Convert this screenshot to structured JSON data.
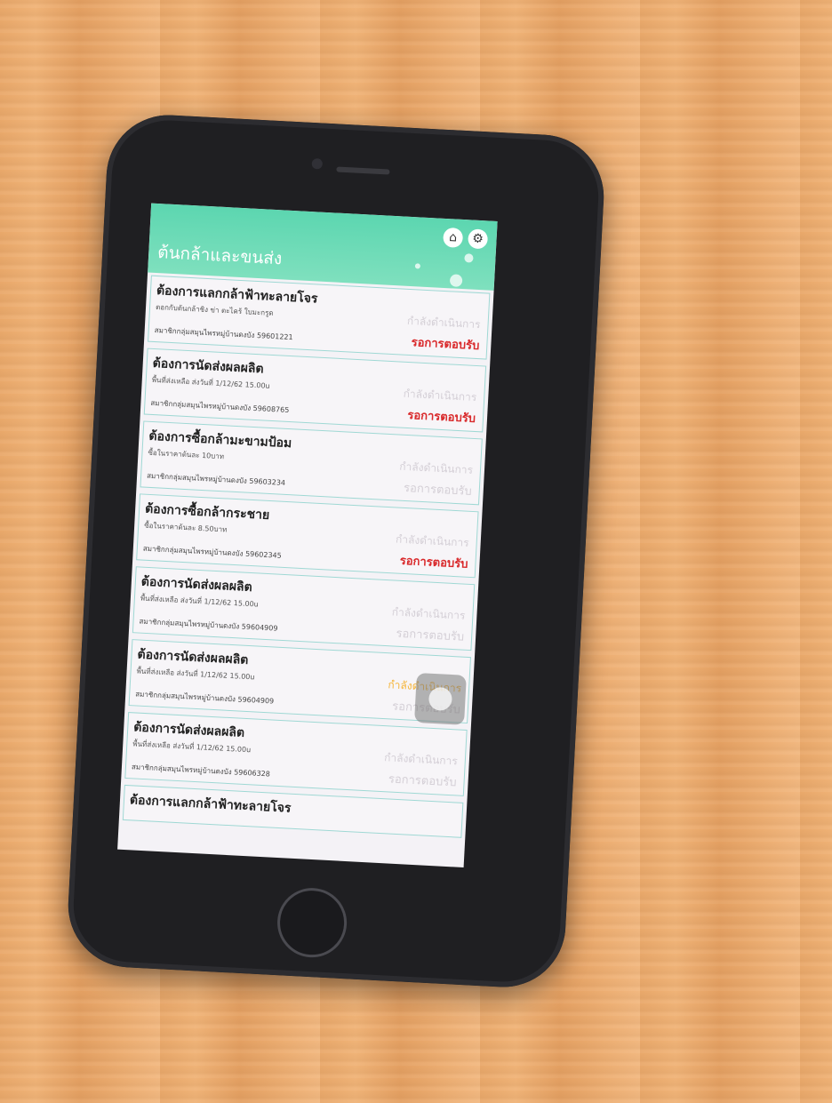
{
  "app": {
    "title": "ต้นกล้าและขนส่ง",
    "home_icon": "home-icon",
    "settings_icon": "gear-icon"
  },
  "cards": [
    {
      "title": "ต้องการแลกกล้าฟ้าทะลายโจร",
      "sub": "ตอกกับต้นกล้าชิง ข่า ตะไคร้ ใบมะกรูด",
      "member": "สมาชิกกลุ่มสมุนไพรหมู่บ้านดงบัง 59601221",
      "progress": "กำลังดำเนินการ",
      "waiting": "รอการตอบรับ",
      "progress_active": false,
      "waiting_active": true
    },
    {
      "title": "ต้องการนัดส่งผลผลิต",
      "sub": "พื้นที่ส่งเหลือ ส่งวันที่ 1/12/62 15.00u",
      "member": "สมาชิกกลุ่มสมุนไพรหมู่บ้านดงบัง 59608765",
      "progress": "กำลังดำเนินการ",
      "waiting": "รอการตอบรับ",
      "progress_active": false,
      "waiting_active": true
    },
    {
      "title": "ต้องการซื้อกล้ามะขามป้อม",
      "sub": "ซื้อในราคาต้นละ 10บาท",
      "member": "สมาชิกกลุ่มสมุนไพรหมู่บ้านดงบัง 59603234",
      "progress": "กำลังดำเนินการ",
      "waiting": "รอการตอบรับ",
      "progress_active": false,
      "waiting_active": false
    },
    {
      "title": "ต้องการซื้อกล้ากระชาย",
      "sub": "ซื้อในราคาต้นละ 8.50บาท",
      "member": "สมาชิกกลุ่มสมุนไพรหมู่บ้านดงบัง 59602345",
      "progress": "กำลังดำเนินการ",
      "waiting": "รอการตอบรับ",
      "progress_active": false,
      "waiting_active": true
    },
    {
      "title": "ต้องการนัดส่งผลผลิต",
      "sub": "พื้นที่ส่งเหลือ ส่งวันที่ 1/12/62 15.00u",
      "member": "สมาชิกกลุ่มสมุนไพรหมู่บ้านดงบัง 59604909",
      "progress": "กำลังดำเนินการ",
      "waiting": "รอการตอบรับ",
      "progress_active": false,
      "waiting_active": false
    },
    {
      "title": "ต้องการนัดส่งผลผลิต",
      "sub": "พื้นที่ส่งเหลือ ส่งวันที่ 1/12/62 15.00u",
      "member": "สมาชิกกลุ่มสมุนไพรหมู่บ้านดงบัง 59604909",
      "progress": "กำลังดำเนินการ",
      "waiting": "รอการตอบรับ",
      "progress_active": true,
      "waiting_active": false
    },
    {
      "title": "ต้องการนัดส่งผลผลิต",
      "sub": "พื้นที่ส่งเหลือ ส่งวันที่ 1/12/62 15.00u",
      "member": "สมาชิกกลุ่มสมุนไพรหมู่บ้านดงบัง 59606328",
      "progress": "กำลังดำเนินการ",
      "waiting": "รอการตอบรับ",
      "progress_active": false,
      "waiting_active": false
    }
  ],
  "partial_card": {
    "title": "ต้องการแลกกล้าฟ้าทะลายโจร"
  },
  "floating_button_icon": "assistive-touch-icon"
}
